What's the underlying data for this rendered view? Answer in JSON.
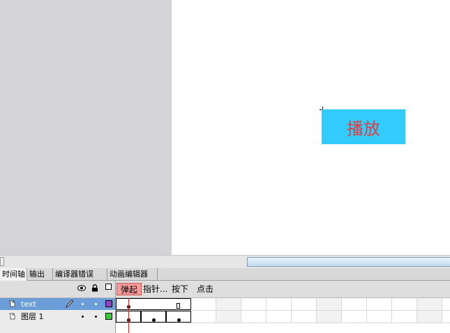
{
  "stage": {
    "button_label": "播放",
    "button_color": "#33ccff",
    "button_text_color": "#e23b3b"
  },
  "panel_tabs": [
    {
      "label": "时间轴",
      "active": true
    },
    {
      "label": "输出",
      "active": false
    },
    {
      "label": "编译器错误",
      "active": false
    },
    {
      "label": "动画编辑器",
      "active": false
    }
  ],
  "timeline": {
    "column_icons": [
      "eye-icon",
      "lock-icon",
      "outline-icon"
    ],
    "frame_labels": [
      "弹起",
      "指针...",
      "按下",
      "点击"
    ],
    "layers": [
      {
        "name": "text",
        "selected": true,
        "outline_color": "#8e44c8"
      },
      {
        "name": "图层 1",
        "selected": false,
        "outline_color": "#33cc33"
      }
    ]
  }
}
